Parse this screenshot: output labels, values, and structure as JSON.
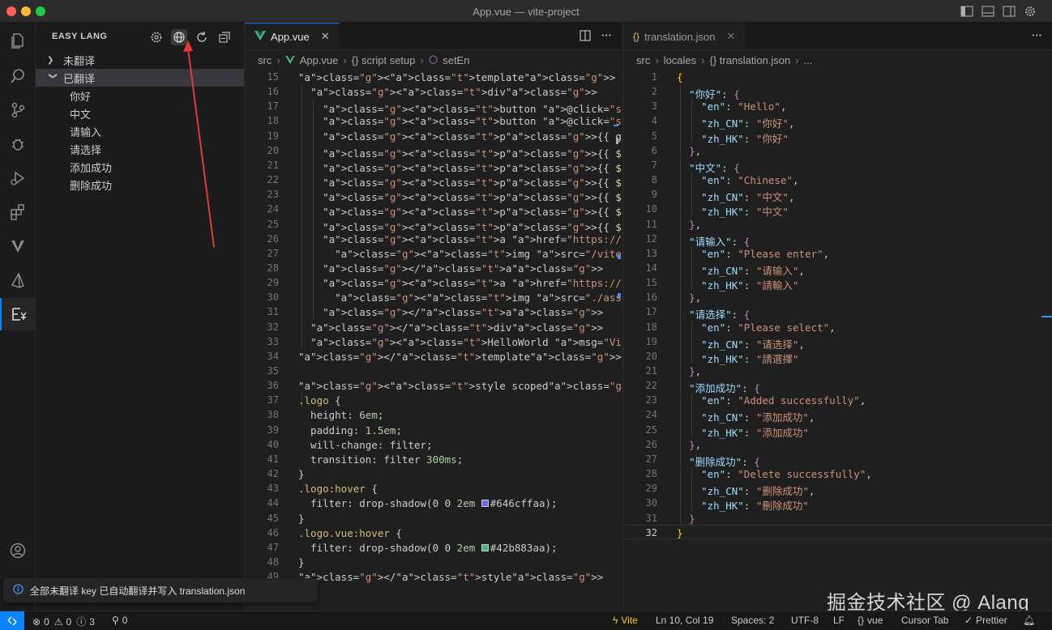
{
  "window": {
    "title": "App.vue — vite-project"
  },
  "sidebar": {
    "header": "EASY LANG",
    "groups": [
      {
        "label": "未翻译",
        "expanded": false,
        "items": []
      },
      {
        "label": "已翻译",
        "expanded": true,
        "items": [
          "你好",
          "中文",
          "请输入",
          "请选择",
          "添加成功",
          "删除成功"
        ]
      }
    ]
  },
  "editor1": {
    "tab": {
      "label": "App.vue",
      "close": "✕"
    },
    "breadcrumb": [
      "src",
      "App.vue",
      "{} script setup",
      "setEn"
    ],
    "line_numbers": [
      "15",
      "16",
      "17",
      "18",
      "19",
      "20",
      "21",
      "22",
      "23",
      "24",
      "25",
      "26",
      "27",
      "28",
      "29",
      "30",
      "31",
      "32",
      "33",
      "34",
      "35",
      "36",
      "37",
      "38",
      "39",
      "40",
      "41",
      "42",
      "43",
      "44",
      "45",
      "46",
      "47",
      "48",
      "49"
    ],
    "lines": [
      "<template>",
      "  <div>",
      "    <button @click=\"setZh\">中文</button>",
      "    <button @click=\"setEn\">English</button>",
      "    <p>{{ getCurrentLang() }}</p>",
      "    <p>{{ $t(\"你好\") }}</p>",
      "    <p>{{ $t(\"中文\") }}</p>",
      "    <p>{{ $t(\"请输入\") }}</p>",
      "    <p>{{ $t(\"请选择\") }}</p>",
      "    <p>{{ $t(\"添加成功\") }}</p>",
      "    <p>{{ $t(\"删除成功\") }}</p>",
      "    <a href=\"https://vite.dev\" target=\"_blank\">",
      "      <img src=\"/vite.svg\" class=\"logo\" alt=\"Vite logo\" />",
      "    </a>",
      "    <a href=\"https://vuejs.org/\" target=\"_blank\">",
      "      <img src=\"./assets/vue.svg\" class=\"logo vue\" alt=\"Vue logo\" />",
      "    </a>",
      "  </div>",
      "  <HelloWorld msg=\"Vite + Vue\" />",
      "</template>",
      "",
      "<style scoped>",
      ".logo {",
      "  height: 6em;",
      "  padding: 1.5em;",
      "  will-change: filter;",
      "  transition: filter 300ms;",
      "}",
      ".logo:hover {",
      "  filter: drop-shadow(0 0 2em #646cffaa);",
      "}",
      ".logo.vue:hover {",
      "  filter: drop-shadow(0 0 2em #42b883aa);",
      "}",
      "</style>"
    ]
  },
  "editor2": {
    "tab": {
      "label": "translation.json",
      "close": "✕"
    },
    "breadcrumb": [
      "src",
      "locales",
      "{} translation.json",
      "..."
    ],
    "line_numbers": [
      "1",
      "2",
      "3",
      "4",
      "5",
      "6",
      "7",
      "8",
      "9",
      "10",
      "11",
      "12",
      "13",
      "14",
      "15",
      "16",
      "17",
      "18",
      "19",
      "20",
      "21",
      "22",
      "23",
      "24",
      "25",
      "26",
      "27",
      "28",
      "29",
      "30",
      "31",
      "32"
    ],
    "current_line": "32",
    "entries": [
      {
        "key": "你好",
        "en": "Hello",
        "zh_CN": "你好",
        "zh_HK": "你好"
      },
      {
        "key": "中文",
        "en": "Chinese",
        "zh_CN": "中文",
        "zh_HK": "中文"
      },
      {
        "key": "请输入",
        "en": "Please enter",
        "zh_CN": "请输入",
        "zh_HK": "請輸入"
      },
      {
        "key": "请选择",
        "en": "Please select",
        "zh_CN": "请选择",
        "zh_HK": "請選擇"
      },
      {
        "key": "添加成功",
        "en": "Added successfully",
        "zh_CN": "添加成功",
        "zh_HK": "添加成功"
      },
      {
        "key": "删除成功",
        "en": "Delete successfully",
        "zh_CN": "删除成功",
        "zh_HK": "刪除成功"
      }
    ]
  },
  "notification": {
    "text": "全部未翻译 key 已自动翻译并写入 translation.json"
  },
  "statusbar": {
    "errors": "0",
    "warnings": "0",
    "infos": "3",
    "ports": "0",
    "vite": "Vite",
    "position": "Ln 10, Col 19",
    "spaces": "Spaces: 2",
    "encoding": "UTF-8",
    "eol": "LF",
    "language": "vue",
    "cursor_tab": "Cursor Tab",
    "prettier": "Prettier"
  },
  "watermark": "掘金技术社区 @ Alang",
  "colors": {
    "accent": "#0a84ff",
    "vue_green": "#42b883",
    "arrow": "#e53935",
    "swatch1": "#646cff",
    "swatch2": "#42b883"
  }
}
